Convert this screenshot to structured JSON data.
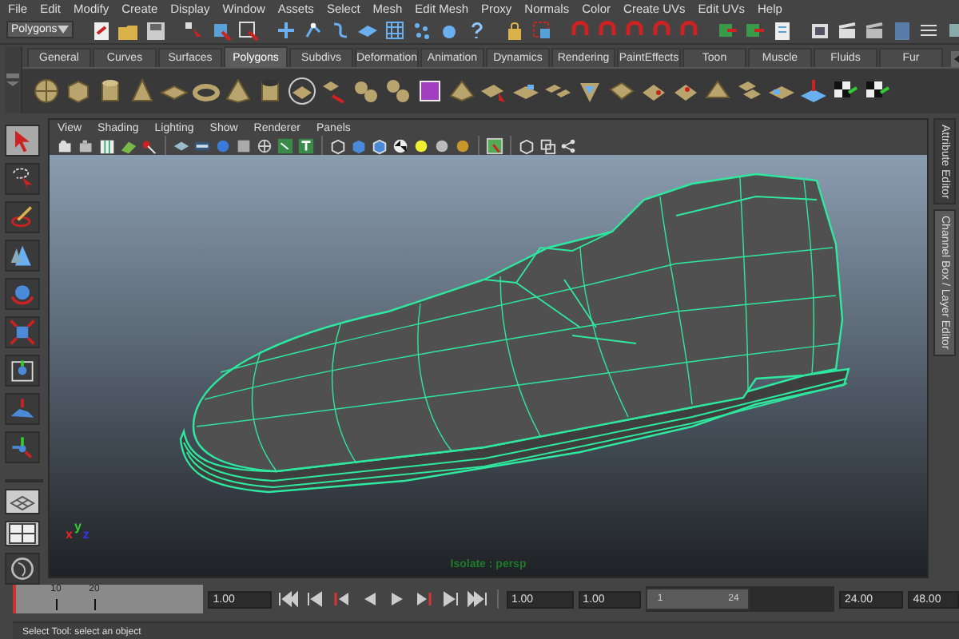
{
  "menu_bar": [
    "File",
    "Edit",
    "Modify",
    "Create",
    "Display",
    "Window",
    "Assets",
    "Select",
    "Mesh",
    "Edit Mesh",
    "Proxy",
    "Normals",
    "Color",
    "Create UVs",
    "Edit UVs",
    "Help"
  ],
  "status_line": {
    "menu_set": "Polygons"
  },
  "shelf": {
    "tabs": [
      {
        "label": "General",
        "selected": false
      },
      {
        "label": "Curves",
        "selected": false
      },
      {
        "label": "Surfaces",
        "selected": false
      },
      {
        "label": "Polygons",
        "selected": true
      },
      {
        "label": "Subdivs",
        "selected": false
      },
      {
        "label": "Deformation",
        "selected": false
      },
      {
        "label": "Animation",
        "selected": false
      },
      {
        "label": "Dynamics",
        "selected": false
      },
      {
        "label": "Rendering",
        "selected": false
      },
      {
        "label": "PaintEffects",
        "selected": false
      },
      {
        "label": "Toon",
        "selected": false
      },
      {
        "label": "Muscle",
        "selected": false
      },
      {
        "label": "Fluids",
        "selected": false
      },
      {
        "label": "Fur",
        "selected": false
      }
    ]
  },
  "toolbox": [
    {
      "selected": true
    },
    {
      "selected": false
    },
    {
      "selected": false
    },
    {
      "selected": false
    },
    {
      "selected": false
    },
    {
      "selected": false
    },
    {
      "selected": false
    },
    {
      "selected": false
    },
    {
      "selected": false
    }
  ],
  "viewport": {
    "panel_menus": [
      "View",
      "Shading",
      "Lighting",
      "Show",
      "Renderer",
      "Panels"
    ],
    "axis_labels": [
      "x",
      "y",
      "z"
    ],
    "camera_label": "Isolate : persp"
  },
  "side_tabs": [
    {
      "label": "Attribute Editor",
      "selected": false
    },
    {
      "label": "Channel Box / Layer Editor",
      "selected": true
    }
  ],
  "time_slider": {
    "ticks": [
      "10",
      "20"
    ],
    "level": 0,
    "current_time": "1.00"
  },
  "range_slider": {
    "start_time": "1.00",
    "playback_start": "1.00",
    "range_start": "1",
    "range_end": "24",
    "level": 0.55,
    "playback_end": "24.00",
    "end_time": "48.00"
  },
  "help_line": "Select Tool: select an object"
}
